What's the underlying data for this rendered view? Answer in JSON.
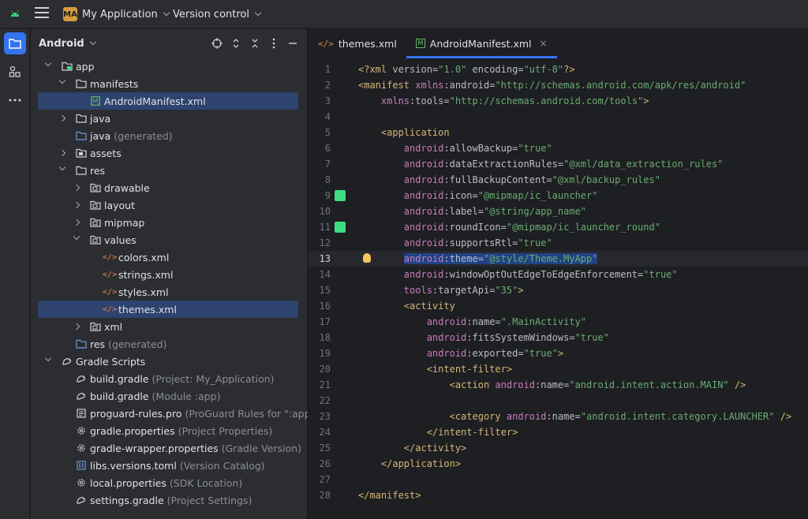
{
  "titlebar": {
    "project_badge": "MA",
    "project_name": "My Application",
    "vcs": "Version control"
  },
  "strip": {
    "icons": [
      "project-folder-icon",
      "structure-icon",
      "more-icon"
    ]
  },
  "project_panel": {
    "view": "Android",
    "tools": [
      "locate-icon",
      "expand-all-icon",
      "collapse-all-icon",
      "options-icon",
      "hide-icon"
    ],
    "tree": [
      {
        "label": "app",
        "note": "",
        "arrow": "down"
      },
      {
        "label": "manifests",
        "note": "",
        "arrow": "down"
      },
      {
        "label": "AndroidManifest.xml",
        "note": "",
        "arrow": "",
        "selected": true
      },
      {
        "label": "java",
        "note": "",
        "arrow": "right"
      },
      {
        "label": "java",
        "note": "(generated)",
        "arrow": ""
      },
      {
        "label": "assets",
        "note": "",
        "arrow": "right"
      },
      {
        "label": "res",
        "note": "",
        "arrow": "down"
      },
      {
        "label": "drawable",
        "note": "",
        "arrow": "right"
      },
      {
        "label": "layout",
        "note": "",
        "arrow": "right"
      },
      {
        "label": "mipmap",
        "note": "",
        "arrow": "right"
      },
      {
        "label": "values",
        "note": "",
        "arrow": "down"
      },
      {
        "label": "colors.xml",
        "note": "",
        "arrow": ""
      },
      {
        "label": "strings.xml",
        "note": "",
        "arrow": ""
      },
      {
        "label": "styles.xml",
        "note": "",
        "arrow": ""
      },
      {
        "label": "themes.xml",
        "note": "",
        "arrow": "",
        "selected": true
      },
      {
        "label": "xml",
        "note": "",
        "arrow": "right"
      },
      {
        "label": "res",
        "note": "(generated)",
        "arrow": ""
      },
      {
        "label": "Gradle Scripts",
        "note": "",
        "arrow": "down"
      },
      {
        "label": "build.gradle",
        "note": "(Project: My_Application)",
        "arrow": ""
      },
      {
        "label": "build.gradle",
        "note": "(Module :app)",
        "arrow": ""
      },
      {
        "label": "proguard-rules.pro",
        "note": "(ProGuard Rules for \":app\")",
        "arrow": ""
      },
      {
        "label": "gradle.properties",
        "note": "(Project Properties)",
        "arrow": ""
      },
      {
        "label": "gradle-wrapper.properties",
        "note": "(Gradle Version)",
        "arrow": ""
      },
      {
        "label": "libs.versions.toml",
        "note": "(Version Catalog)",
        "arrow": ""
      },
      {
        "label": "local.properties",
        "note": "(SDK Location)",
        "arrow": ""
      },
      {
        "label": "settings.gradle",
        "note": "(Project Settings)",
        "arrow": ""
      }
    ]
  },
  "editor": {
    "tabs": [
      {
        "label": "themes.xml",
        "active": false
      },
      {
        "label": "AndroidManifest.xml",
        "active": true,
        "close": "×"
      }
    ],
    "current_line": 13,
    "lines": [
      "<?xml version=\"1.0\" encoding=\"utf-8\"?>",
      "<manifest xmlns:android=\"http://schemas.android.com/apk/res/android\"",
      "    xmlns:tools=\"http://schemas.android.com/tools\">",
      "",
      "    <application",
      "        android:allowBackup=\"true\"",
      "        android:dataExtractionRules=\"@xml/data_extraction_rules\"",
      "        android:fullBackupContent=\"@xml/backup_rules\"",
      "        android:icon=\"@mipmap/ic_launcher\"",
      "        android:label=\"@string/app_name\"",
      "        android:roundIcon=\"@mipmap/ic_launcher_round\"",
      "        android:supportsRtl=\"true\"",
      "        android:theme=\"@style/Theme.MyApp\"",
      "        android:windowOptOutEdgeToEdgeEnforcement=\"true\"",
      "        tools:targetApi=\"35\">",
      "        <activity",
      "            android:name=\".MainActivity\"",
      "            android:fitsSystemWindows=\"true\"",
      "            android:exported=\"true\">",
      "            <intent-filter>",
      "                <action android:name=\"android.intent.action.MAIN\" />",
      "",
      "                <category android:name=\"android.intent.category.LAUNCHER\" />",
      "            </intent-filter>",
      "        </activity>",
      "    </application>",
      "",
      "</manifest>"
    ],
    "gutter_icons": [
      9,
      11
    ]
  }
}
